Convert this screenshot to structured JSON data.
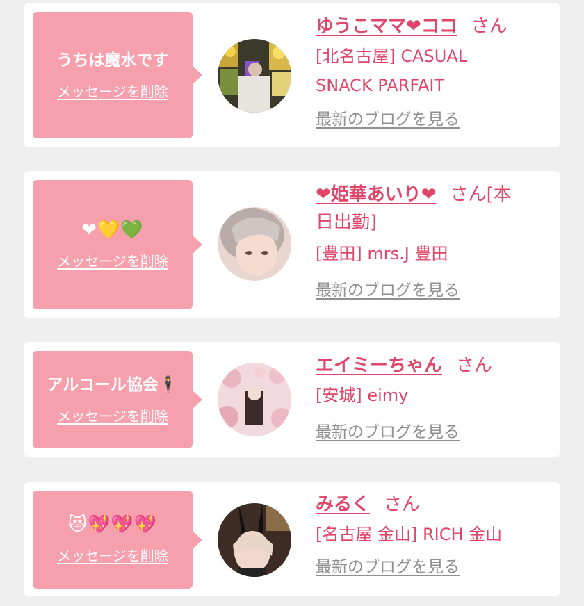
{
  "delete_label": "メッセージを削除",
  "san_label": "さん",
  "blog_label": "最新のブログを見る",
  "cards": [
    {
      "message": "うちは魔水です",
      "name": "ゆうこママ❤ココ",
      "shop_line1": "[北名古屋] CASUAL",
      "shop_line2": "SNACK PARFAIT",
      "avatar": "profile-photo"
    },
    {
      "message": "❤💛💚",
      "name": "❤姫華あいり❤",
      "status": "[本日出勤]",
      "status_a": "[本",
      "status_b": "日出勤]",
      "shop_line1": "[豊田] mrs.J 豊田",
      "avatar": "profile-photo"
    },
    {
      "message": "アルコール協会🕴",
      "name": "エイミーちゃん",
      "shop_line1": "[安城] eimy",
      "avatar": "profile-photo"
    },
    {
      "message": "😻💖💖💖",
      "name": "みるく",
      "shop_line1": "[名古屋 金山] RICH 金山",
      "avatar": "profile-photo"
    }
  ],
  "colors": {
    "accent": "#e0456a",
    "bubble": "#f7a0ad",
    "link_gray": "#909090",
    "background": "#efefef"
  }
}
